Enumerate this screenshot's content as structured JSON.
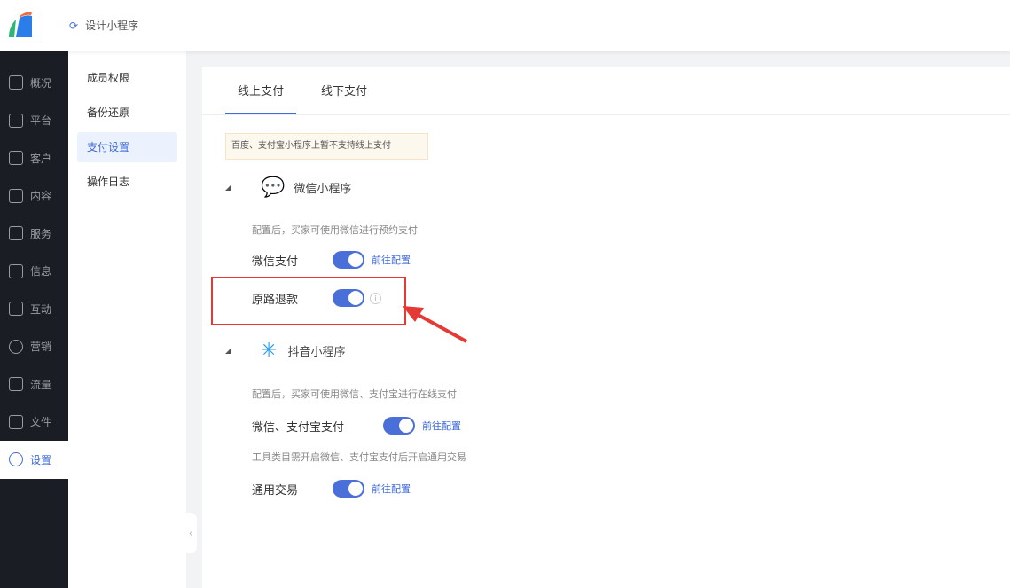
{
  "header": {
    "app_title": "设计小程序"
  },
  "sidebar": {
    "items": [
      {
        "label": "概况"
      },
      {
        "label": "平台"
      },
      {
        "label": "客户"
      },
      {
        "label": "内容"
      },
      {
        "label": "服务"
      },
      {
        "label": "信息"
      },
      {
        "label": "互动"
      },
      {
        "label": "营销"
      },
      {
        "label": "流量"
      },
      {
        "label": "文件"
      },
      {
        "label": "设置"
      }
    ]
  },
  "submenu": {
    "items": [
      "成员权限",
      "备份还原",
      "支付设置",
      "操作日志"
    ]
  },
  "tabs": [
    "线上支付",
    "线下支付"
  ],
  "notice": "百度、支付宝小程序上暂不支持线上支付",
  "wechat": {
    "title": "微信小程序",
    "desc": "配置后，买家可使用微信进行预约支付",
    "pay_label": "微信支付",
    "pay_link": "前往配置",
    "refund_label": "原路退款"
  },
  "douyin": {
    "title": "抖音小程序",
    "desc": "配置后，买家可使用微信、支付宝进行在线支付",
    "pay_label": "微信、支付宝支付",
    "pay_link": "前往配置",
    "note": "工具类目需开启微信、支付宝支付后开启通用交易",
    "trade_label": "通用交易",
    "trade_link": "前往配置"
  },
  "colors": {
    "accent": "#3f6ad8",
    "sidebar": "#1b1d24",
    "highlight": "#e53935"
  }
}
